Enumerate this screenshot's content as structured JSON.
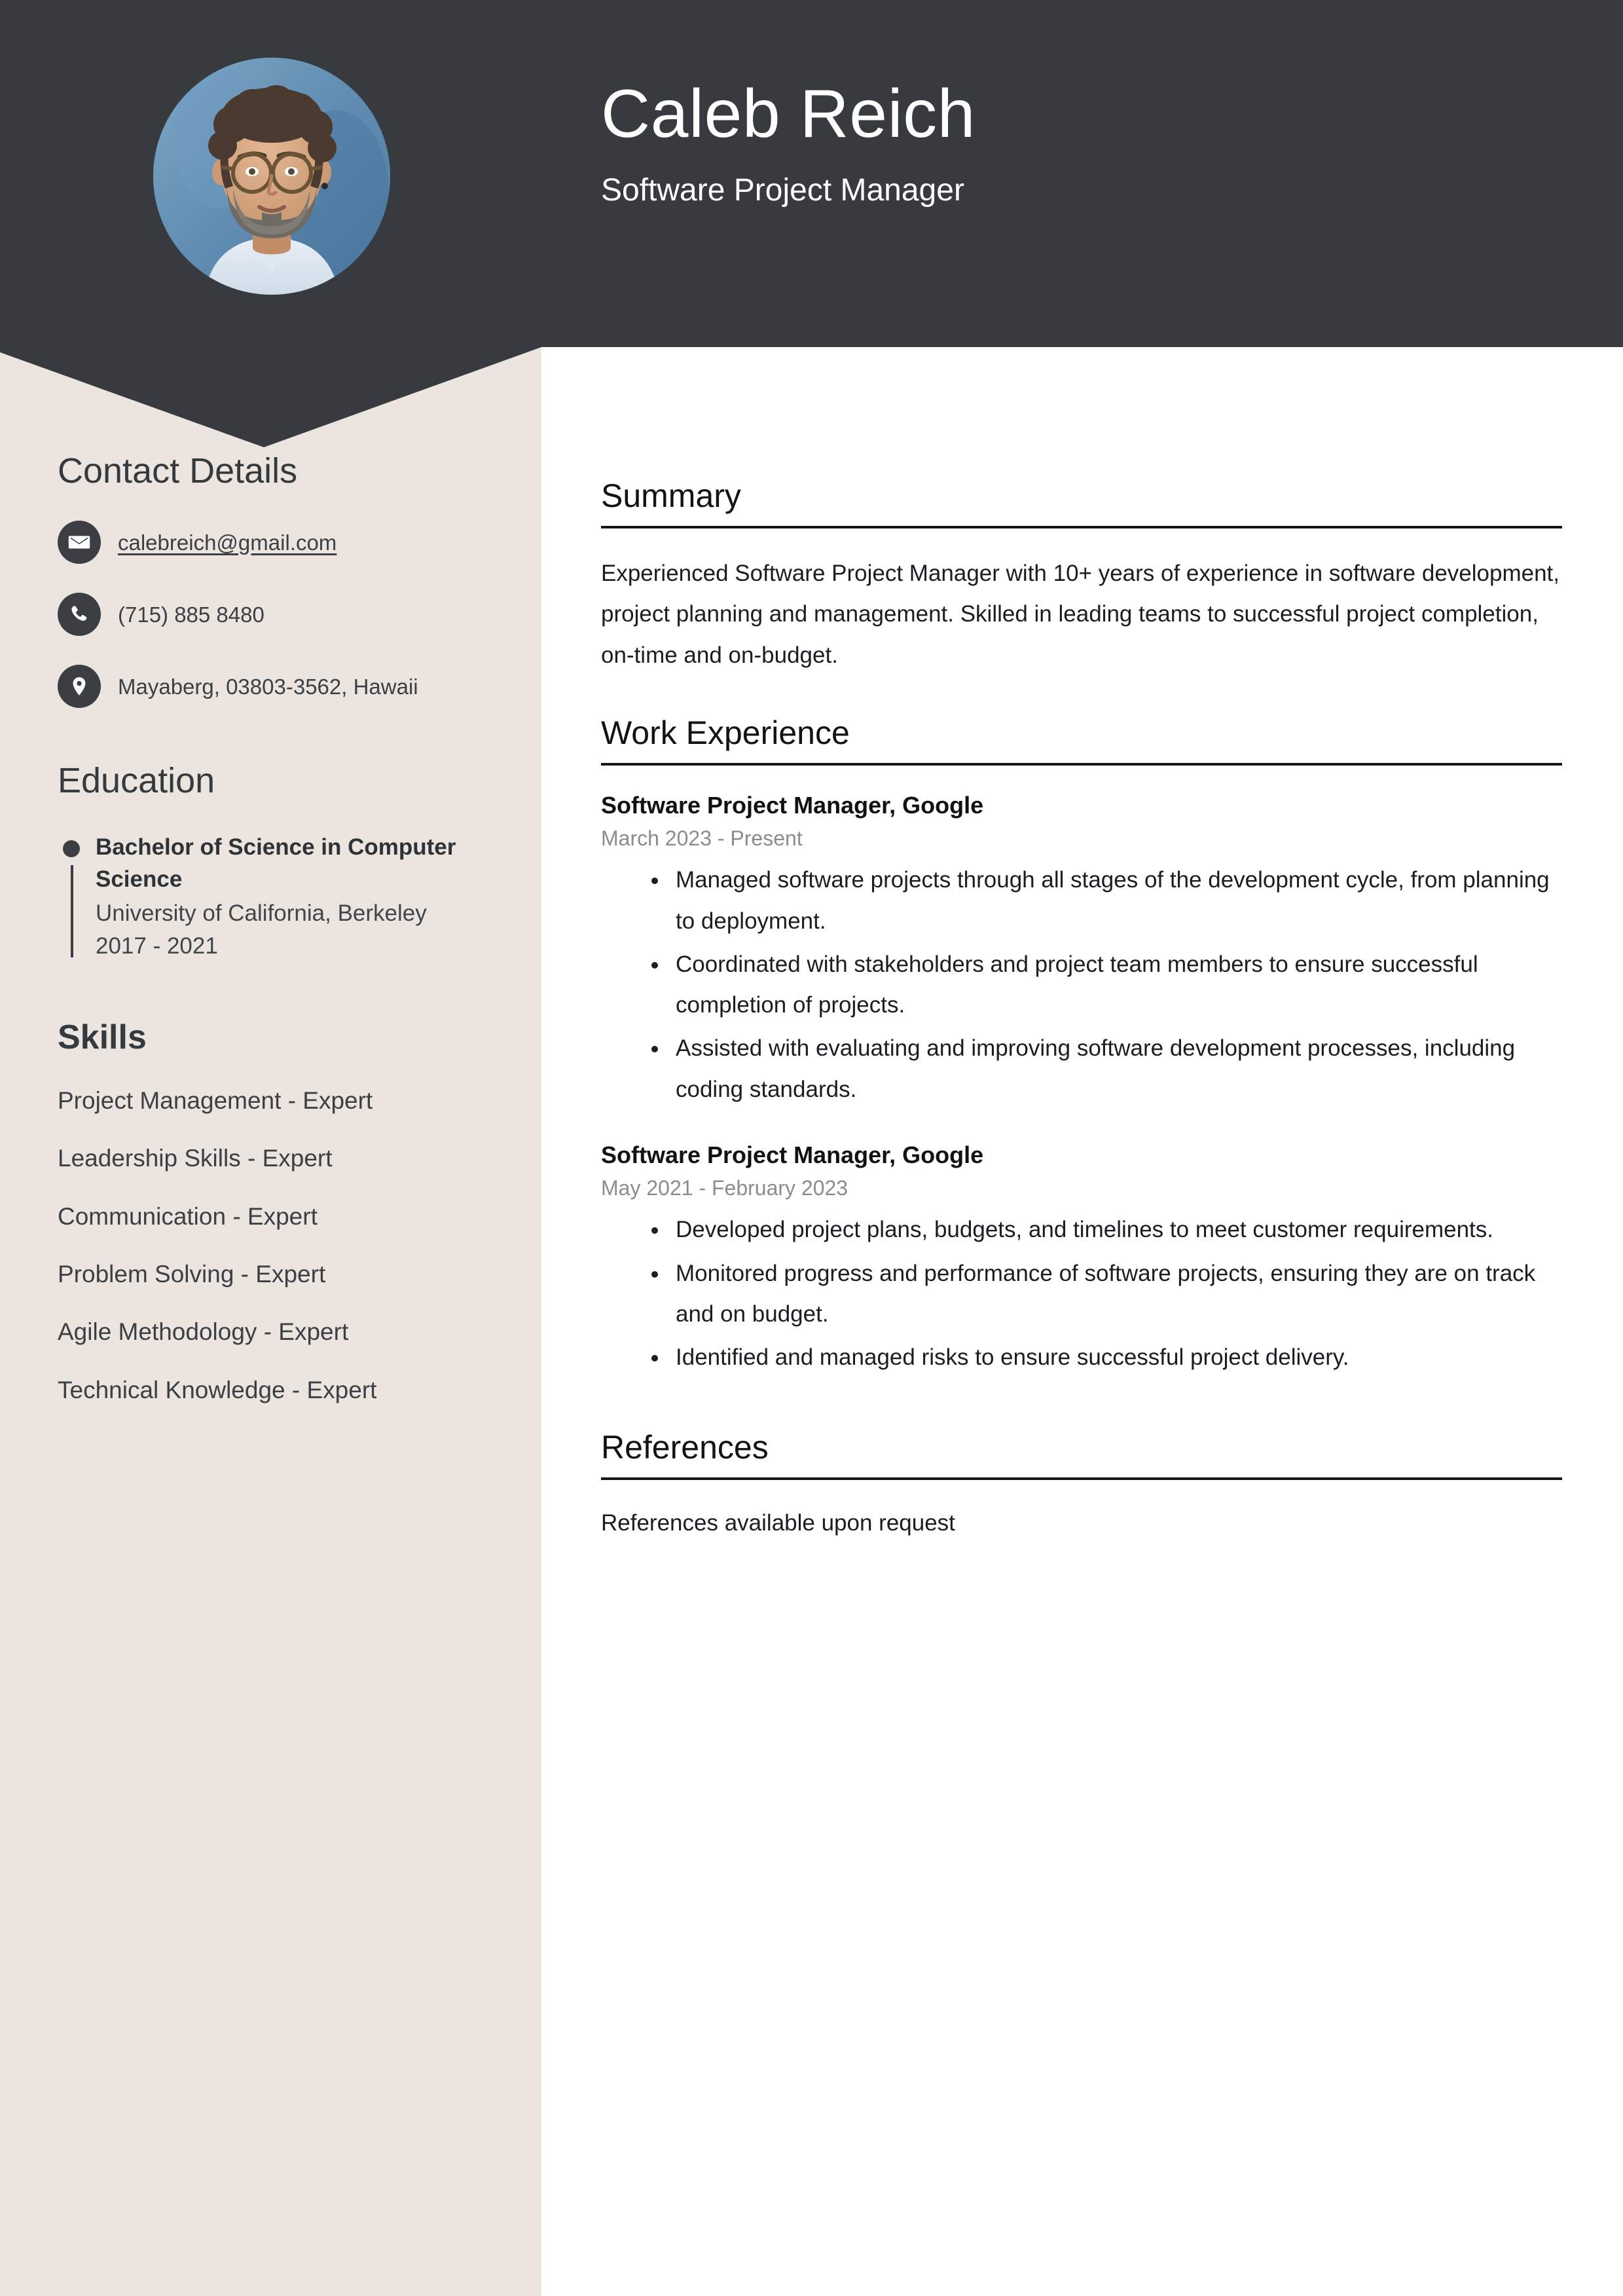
{
  "theme": {
    "dark": "#373a3e",
    "sidebar_bg": "#ece4de",
    "page_bg": "#ffffff",
    "muted_text": "#8c8c8c",
    "body_text": "#1b1e21"
  },
  "header": {
    "name": "Caleb Reich",
    "job_title": "Software Project Manager",
    "avatar_alt": "profile-photo"
  },
  "sidebar": {
    "contact": {
      "heading": "Contact Details",
      "items": [
        {
          "icon": "email-icon",
          "value": "calebreich@gmail.com",
          "is_link": true
        },
        {
          "icon": "phone-icon",
          "value": "(715) 885 8480",
          "is_link": false
        },
        {
          "icon": "location-icon",
          "value": "Mayaberg, 03803-3562, Hawaii",
          "is_link": false
        }
      ]
    },
    "education": {
      "heading": "Education",
      "items": [
        {
          "degree": "Bachelor of Science in Computer Science",
          "school": "University of California, Berkeley",
          "dates": "2017 - 2021"
        }
      ]
    },
    "skills": {
      "heading": "Skills",
      "items": [
        "Project Management - Expert",
        "Leadership Skills - Expert",
        "Communication - Expert",
        "Problem Solving - Expert",
        "Agile Methodology - Expert",
        "Technical Knowledge - Expert"
      ]
    }
  },
  "main": {
    "summary": {
      "heading": "Summary",
      "text": "Experienced Software Project Manager with 10+ years of experience in software development, project planning and management. Skilled in leading teams to successful project completion, on-time and on-budget."
    },
    "work_experience": {
      "heading": "Work Experience",
      "jobs": [
        {
          "role": "Software Project Manager, Google",
          "dates": "March 2023 - Present",
          "bullets": [
            "Managed software projects through all stages of the development cycle, from planning to deployment.",
            "Coordinated with stakeholders and project team members to ensure successful completion of projects.",
            "Assisted with evaluating and improving software development processes, including coding standards."
          ]
        },
        {
          "role": "Software Project Manager, Google",
          "dates": "May 2021 - February 2023",
          "bullets": [
            "Developed project plans, budgets, and timelines to meet customer requirements.",
            "Monitored progress and performance of software projects, ensuring they are on track and on budget.",
            "Identified and managed risks to ensure successful project delivery."
          ]
        }
      ]
    },
    "references": {
      "heading": "References",
      "text": "References available upon request"
    }
  }
}
